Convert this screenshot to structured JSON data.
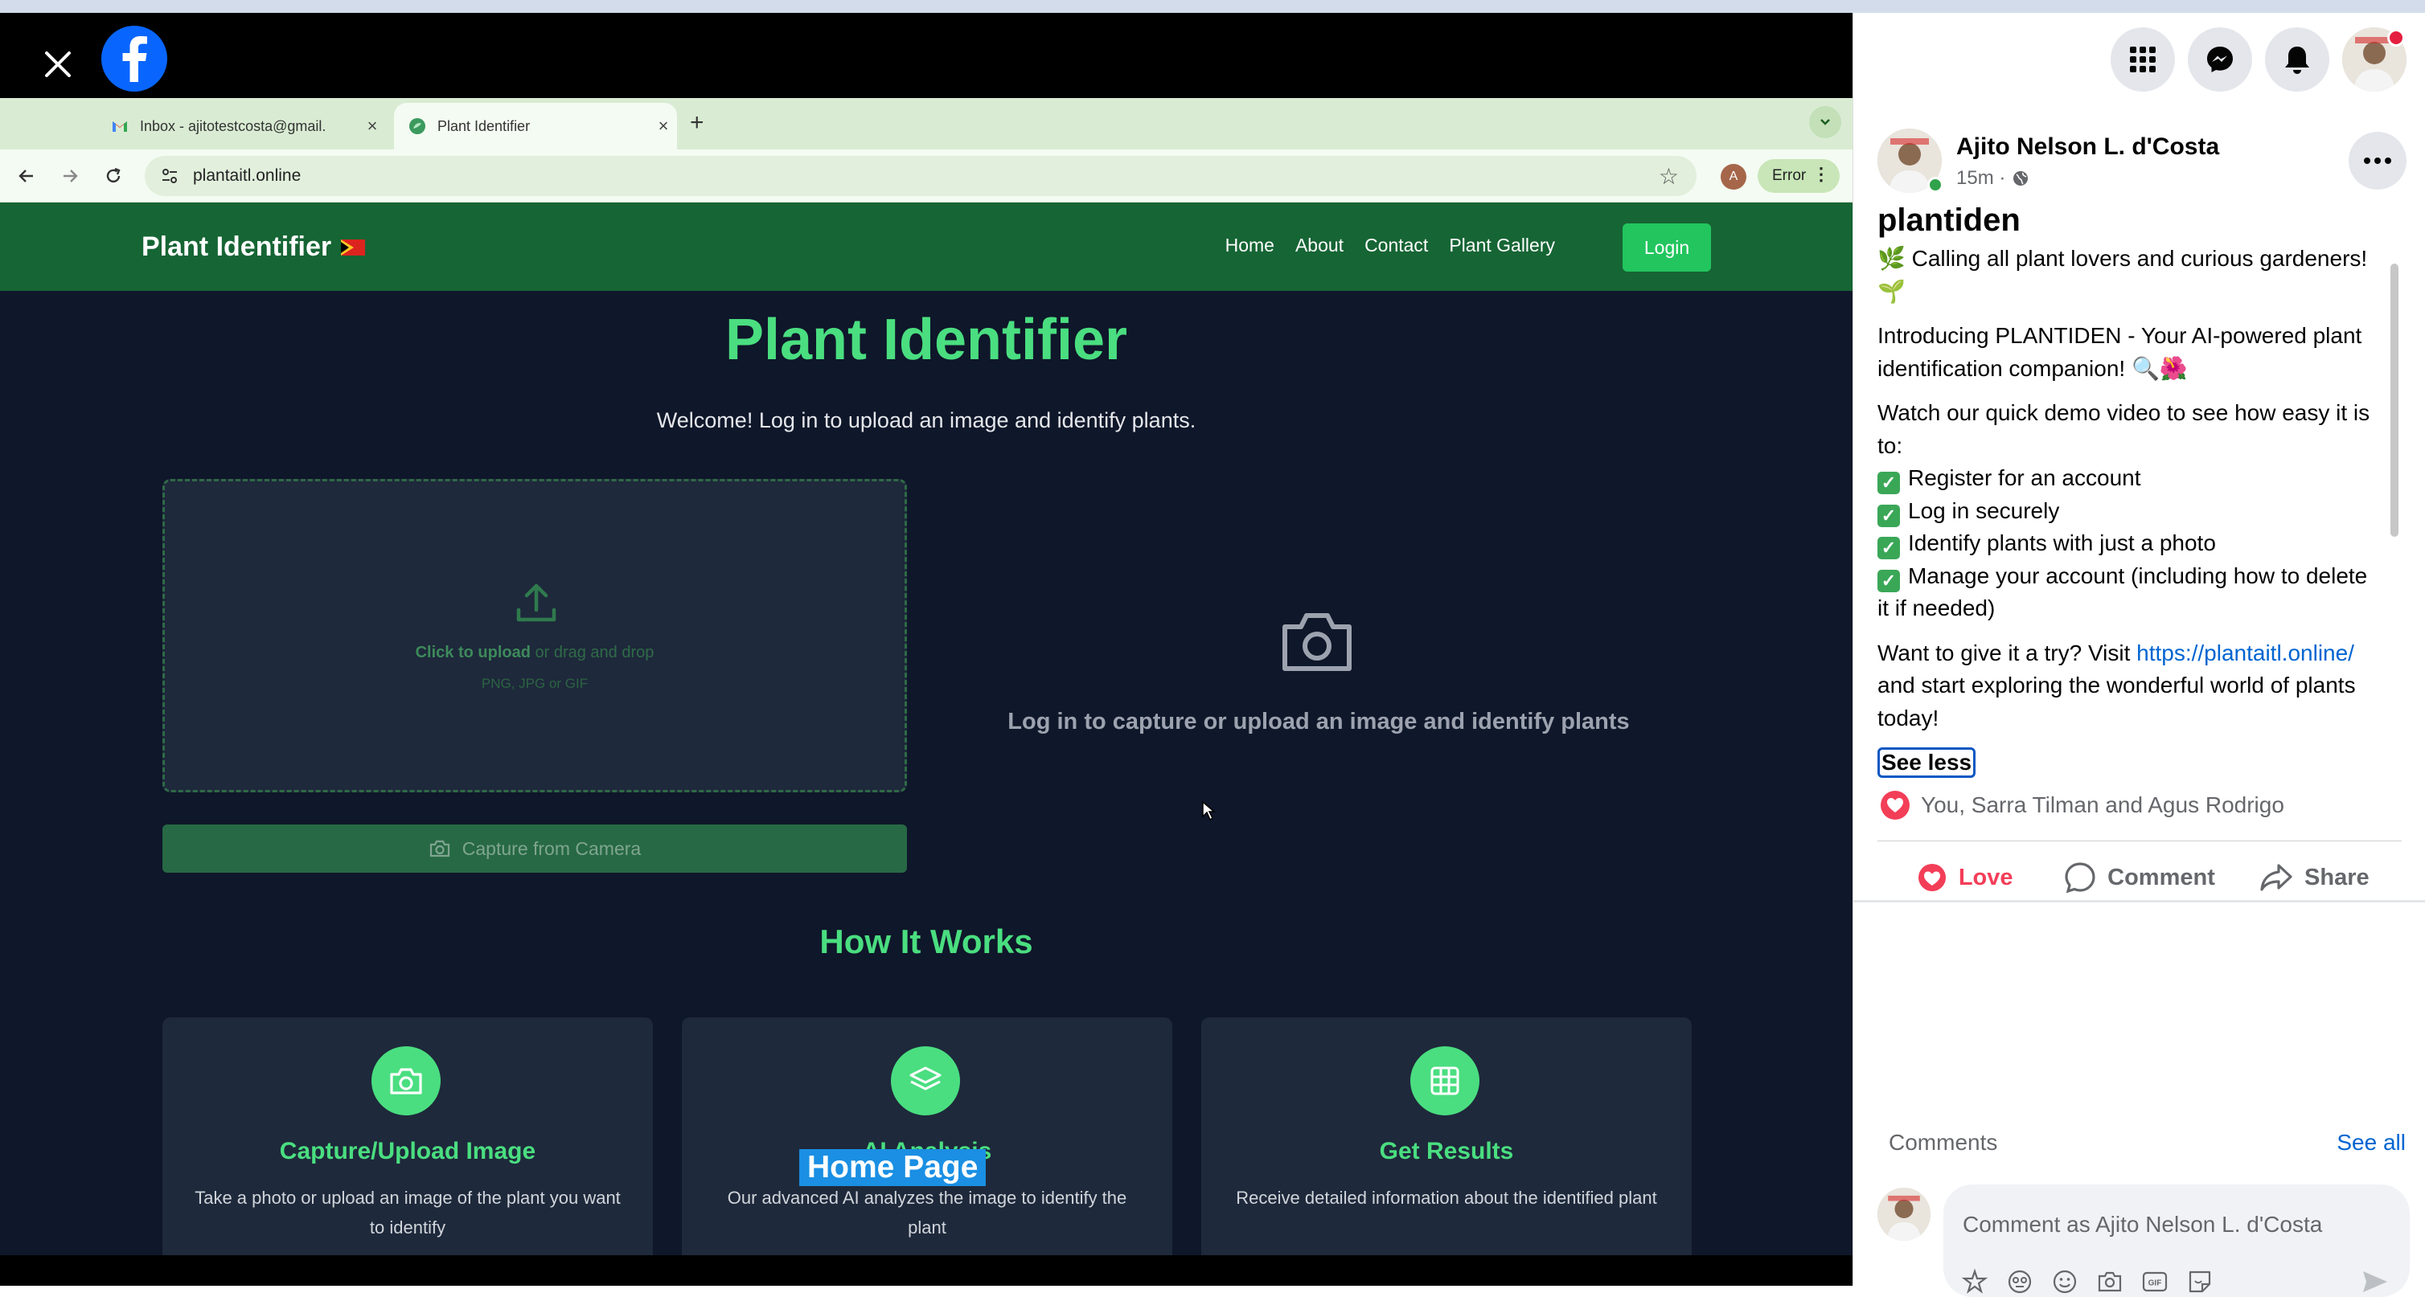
{
  "viewer": {
    "close_icon": "close-icon",
    "logo": "facebook-logo",
    "browser": {
      "tabs": [
        {
          "title": "Inbox - ajitotestcosta@gmail.",
          "icon": "gmail-icon",
          "active": false
        },
        {
          "title": "Plant Identifier",
          "icon": "plant-favicon",
          "active": true
        }
      ],
      "url": "plantaitl.online",
      "profile_initial": "A",
      "error_label": "Error"
    },
    "site": {
      "brand": "Plant Identifier",
      "nav": [
        "Home",
        "About",
        "Contact",
        "Plant Gallery"
      ],
      "login": "Login",
      "hero_title": "Plant Identifier",
      "hero_subtitle": "Welcome! Log in to upload an image and identify plants.",
      "dropzone": {
        "click": "Click to upload",
        "drag": " or drag and drop",
        "types": "PNG, JPG or GIF"
      },
      "capture_button": "Capture from Camera",
      "login_prompt": "Log in to capture or upload an image and identify plants",
      "how_title": "How It Works",
      "cards": [
        {
          "icon": "camera-icon",
          "title": "Capture/Upload Image",
          "desc": "Take a photo or upload an image of the plant you want to identify"
        },
        {
          "icon": "layers-icon",
          "title": "AI Analysis",
          "desc": "Our advanced AI analyzes the image to identify the plant"
        },
        {
          "icon": "grid-icon",
          "title": "Get Results",
          "desc": "Receive detailed information about the identified plant"
        }
      ],
      "overlay_label": "Home Page"
    }
  },
  "panel": {
    "header_icons": [
      "menu-grid-icon",
      "messenger-icon",
      "bell-icon"
    ],
    "author": "Ajito Nelson L. d'Costa",
    "time": "15m ·",
    "post_title": "plantiden",
    "p1": "🌿 Calling all plant lovers and curious gardeners! 🌱",
    "p2": "Introducing PLANTIDEN - Your AI-powered plant identification companion! 🔍🌺",
    "p3_intro": "Watch our quick demo video to see how easy it is to:",
    "checklist": [
      "Register for an account",
      "Log in securely",
      "Identify plants with just a photo",
      "Manage your account (including how to delete it if needed)"
    ],
    "p4_pre": "Want to give it a try? Visit ",
    "p4_link": "https://plantaitl.online/",
    "p4_post": " and start exploring the wonderful world of plants today!",
    "see_less": "See less",
    "reactions": "You, Sarra Tilman and Agus Rodrigo",
    "actions": {
      "love": "Love",
      "comment": "Comment",
      "share": "Share"
    },
    "comments_label": "Comments",
    "see_all": "See all",
    "comment_placeholder": "Comment as Ajito Nelson L. d'Costa",
    "colors": {
      "love": "#f33e58",
      "link": "#0064d1",
      "fb_blue": "#0866ff",
      "site_green": "#166534",
      "accent_green": "#4ade80"
    }
  }
}
